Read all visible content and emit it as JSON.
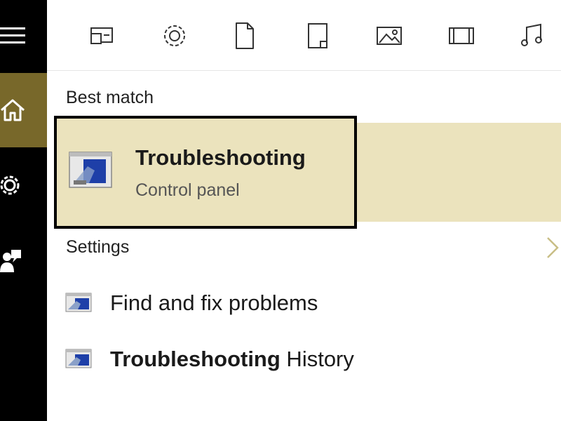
{
  "rail": {
    "items": [
      {
        "name": "hamburger-menu-icon"
      },
      {
        "name": "home-icon",
        "selected": true
      },
      {
        "name": "gear-icon"
      },
      {
        "name": "people-icon"
      }
    ],
    "accent": "#78682a"
  },
  "filters": [
    {
      "name": "apps-filter-icon"
    },
    {
      "name": "settings-filter-icon"
    },
    {
      "name": "documents-filter-icon"
    },
    {
      "name": "folders-filter-icon"
    },
    {
      "name": "photos-filter-icon"
    },
    {
      "name": "videos-filter-icon"
    },
    {
      "name": "music-filter-icon"
    }
  ],
  "best_match": {
    "heading": "Best match",
    "title": "Troubleshooting",
    "subtitle": "Control panel",
    "highlight_color": "#ebe3bd"
  },
  "settings": {
    "heading": "Settings",
    "items": [
      {
        "text": "Find and fix problems"
      },
      {
        "bold": "Troubleshooting",
        "rest": " History"
      }
    ]
  }
}
